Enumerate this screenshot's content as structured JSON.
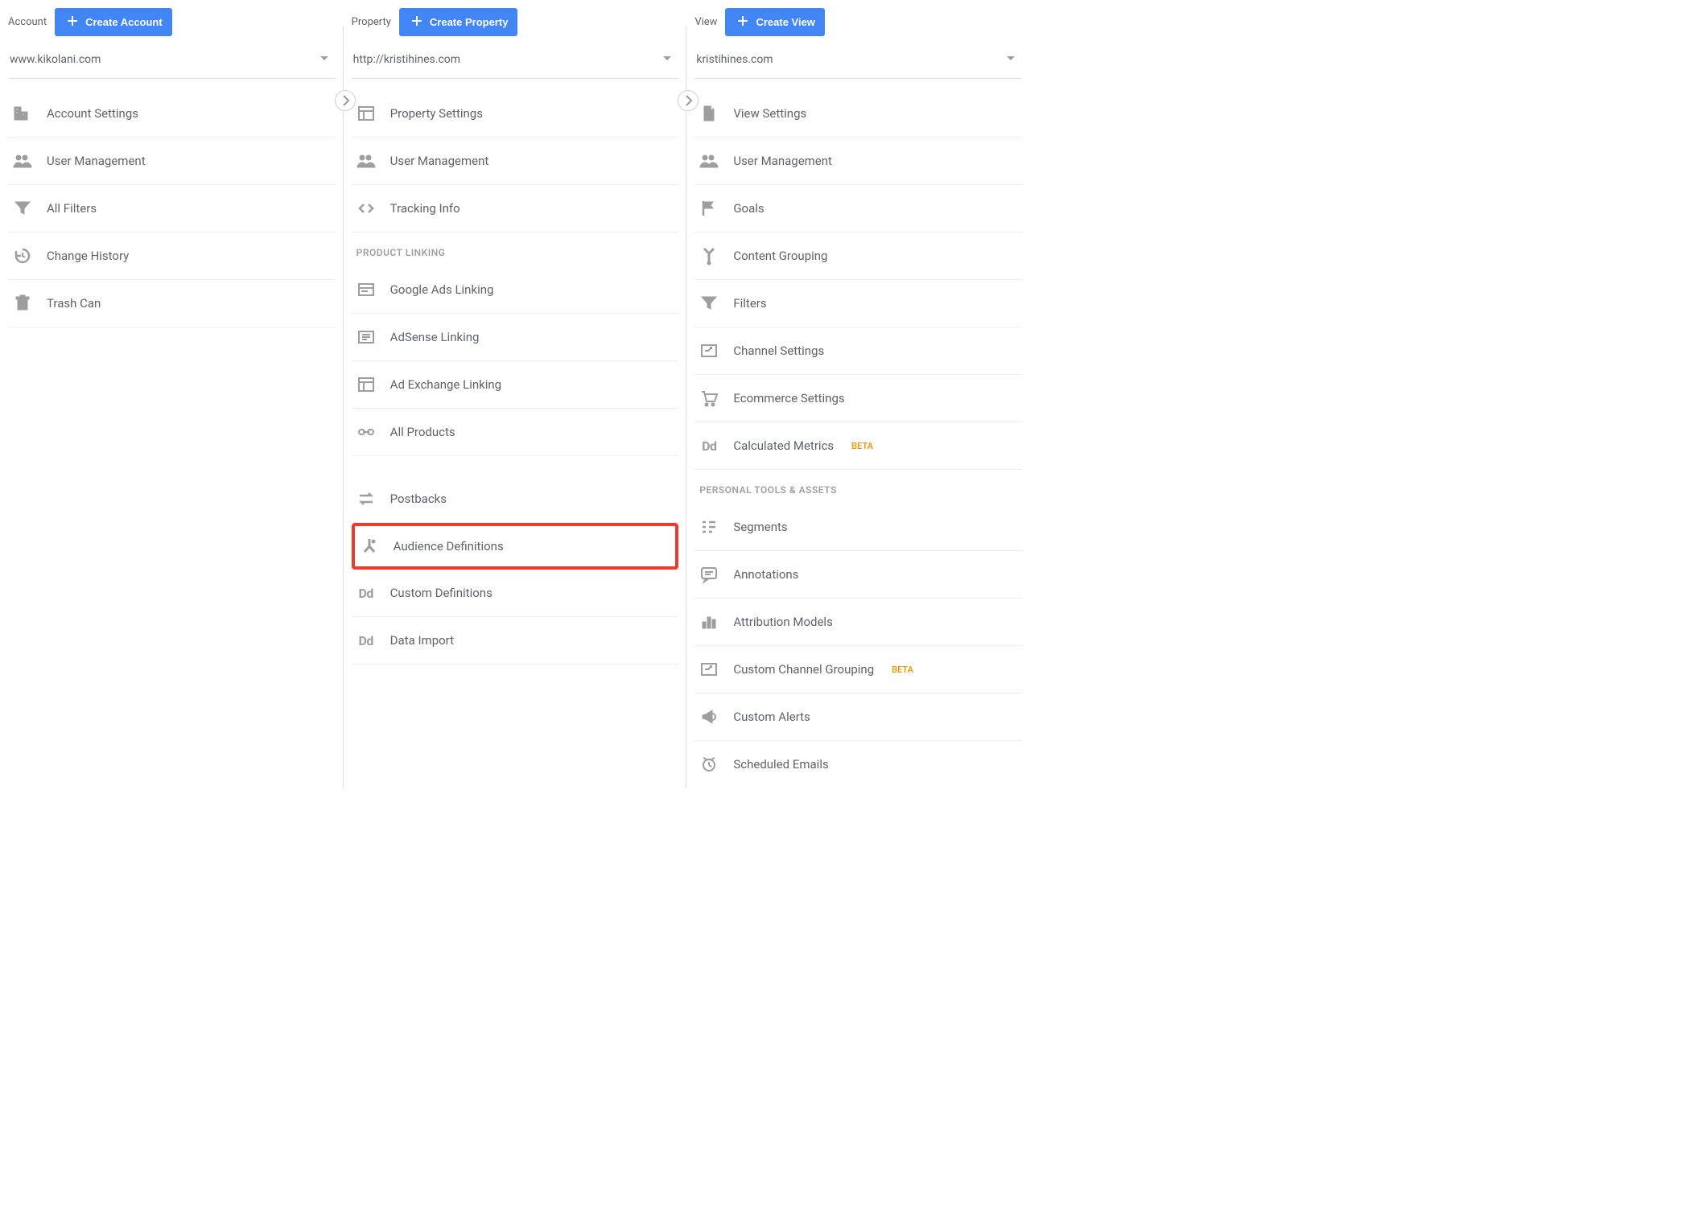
{
  "account": {
    "title": "Account",
    "create_btn": "Create Account",
    "selected": "www.kikolani.com",
    "items": [
      {
        "id": "account-settings",
        "label": "Account Settings",
        "icon": "building"
      },
      {
        "id": "account-user-management",
        "label": "User Management",
        "icon": "people"
      },
      {
        "id": "all-filters",
        "label": "All Filters",
        "icon": "funnel"
      },
      {
        "id": "change-history",
        "label": "Change History",
        "icon": "history"
      },
      {
        "id": "trash-can",
        "label": "Trash Can",
        "icon": "trash"
      }
    ]
  },
  "property": {
    "title": "Property",
    "create_btn": "Create Property",
    "selected": "http://kristihines.com",
    "items": [
      {
        "id": "property-settings",
        "label": "Property Settings",
        "icon": "layout"
      },
      {
        "id": "property-user-management",
        "label": "User Management",
        "icon": "people"
      },
      {
        "id": "tracking-info",
        "label": "Tracking Info",
        "icon": "code"
      }
    ],
    "section1_title": "PRODUCT LINKING",
    "section1_items": [
      {
        "id": "google-ads-linking",
        "label": "Google Ads Linking",
        "icon": "ads"
      },
      {
        "id": "adsense-linking",
        "label": "AdSense Linking",
        "icon": "todo"
      },
      {
        "id": "ad-exchange-linking",
        "label": "Ad Exchange Linking",
        "icon": "layout"
      },
      {
        "id": "all-products",
        "label": "All Products",
        "icon": "link"
      }
    ],
    "extra_items": [
      {
        "id": "postbacks",
        "label": "Postbacks",
        "icon": "swap"
      },
      {
        "id": "audience-definitions",
        "label": "Audience Definitions",
        "icon": "split",
        "highlight": true
      },
      {
        "id": "custom-definitions",
        "label": "Custom Definitions",
        "icon": "dd"
      },
      {
        "id": "data-import",
        "label": "Data Import",
        "icon": "dd"
      }
    ]
  },
  "view": {
    "title": "View",
    "create_btn": "Create View",
    "selected": "kristihines.com",
    "items": [
      {
        "id": "view-settings",
        "label": "View Settings",
        "icon": "doc"
      },
      {
        "id": "view-user-management",
        "label": "User Management",
        "icon": "people"
      },
      {
        "id": "goals",
        "label": "Goals",
        "icon": "flag"
      },
      {
        "id": "content-grouping",
        "label": "Content Grouping",
        "icon": "merge"
      },
      {
        "id": "filters",
        "label": "Filters",
        "icon": "funnel"
      },
      {
        "id": "channel-settings",
        "label": "Channel Settings",
        "icon": "channel"
      },
      {
        "id": "ecommerce-settings",
        "label": "Ecommerce Settings",
        "icon": "cart"
      },
      {
        "id": "calculated-metrics",
        "label": "Calculated Metrics",
        "icon": "dd",
        "beta": "BETA"
      }
    ],
    "section1_title": "PERSONAL TOOLS & ASSETS",
    "section1_items": [
      {
        "id": "segments",
        "label": "Segments",
        "icon": "segments"
      },
      {
        "id": "annotations",
        "label": "Annotations",
        "icon": "annotation"
      },
      {
        "id": "attribution-models",
        "label": "Attribution Models",
        "icon": "bars"
      },
      {
        "id": "custom-channel-grouping",
        "label": "Custom Channel Grouping",
        "icon": "channel",
        "beta": "BETA"
      },
      {
        "id": "custom-alerts",
        "label": "Custom Alerts",
        "icon": "megaphone"
      },
      {
        "id": "scheduled-emails",
        "label": "Scheduled Emails",
        "icon": "clock",
        "no_border": true
      }
    ]
  }
}
